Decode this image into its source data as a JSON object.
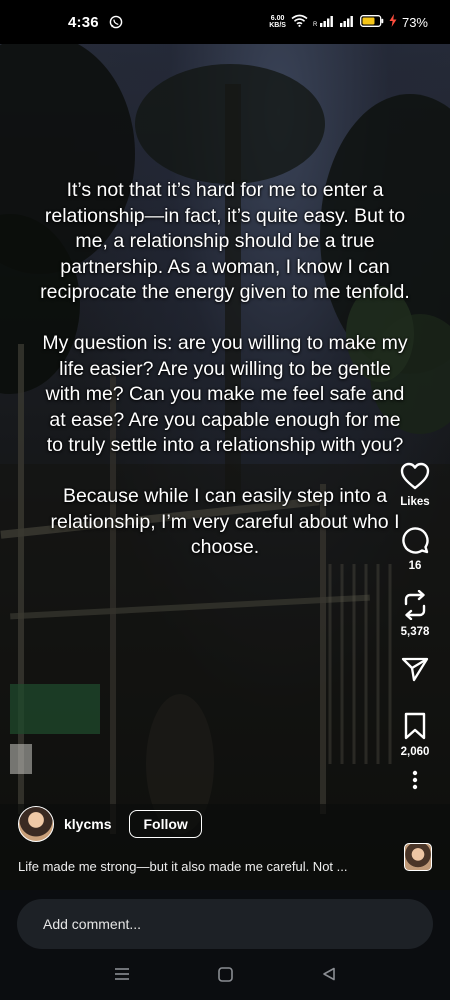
{
  "status_bar": {
    "time": "4:36",
    "network_speed_value": "6.00",
    "network_speed_unit": "KB/S",
    "battery_percent": "73%",
    "icons": [
      "whatsapp-icon",
      "wifi-icon",
      "signal-icon",
      "signal-icon",
      "battery-icon",
      "charging-icon"
    ]
  },
  "post": {
    "overlay_paragraphs": [
      "It’s not that it’s hard for me to enter a relationship—in fact, it’s quite easy. But to me, a relationship should be a true partnership. As a woman, I know I can reciprocate the energy given to me tenfold.",
      "My question is: are you willing to make my life easier? Are you willing to be gentle with me? Can you make me feel safe and at ease? Are you capable enough for me to truly settle into a relationship with you?",
      "Because while I can easily step into a relationship, I’m very careful about who I choose."
    ],
    "author": {
      "username": "klycms",
      "follow_label": "Follow"
    },
    "caption": "Life made me strong—but it also made me careful. Not ..."
  },
  "actions": {
    "likes_label": "Likes",
    "comments_count": "16",
    "reposts_count": "5,378",
    "saves_count": "2,060",
    "icons": [
      "heart-icon",
      "comment-icon",
      "repost-icon",
      "send-icon",
      "bookmark-icon",
      "more-icon"
    ]
  },
  "comment_bar": {
    "placeholder": "Add comment..."
  },
  "nav_bar": {
    "icons": [
      "menu-icon",
      "home-icon",
      "back-icon"
    ]
  },
  "colors": {
    "background": "#0b0d10",
    "comment_box": "#1d2126",
    "battery_fill": "#f5c518",
    "charging": "#ff4d3d"
  }
}
